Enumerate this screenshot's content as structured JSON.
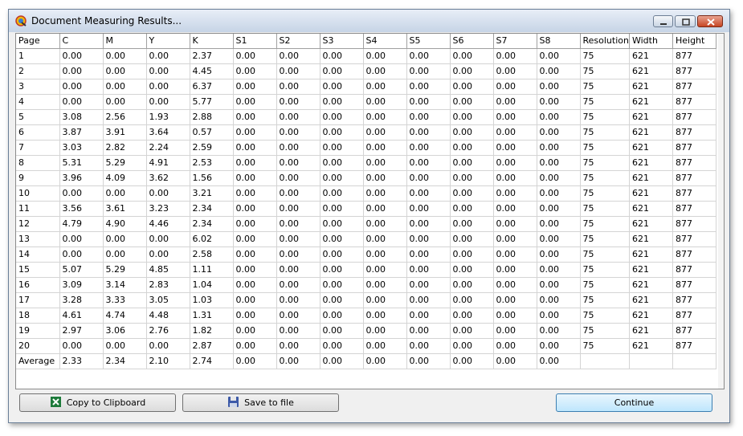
{
  "window": {
    "title": "Document Measuring Results...",
    "icon": "app-logo-icon"
  },
  "table": {
    "columns": [
      "Page",
      "C",
      "M",
      "Y",
      "K",
      "S1",
      "S2",
      "S3",
      "S4",
      "S5",
      "S6",
      "S7",
      "S8",
      "Resolution",
      "Width",
      "Height"
    ],
    "rows": [
      [
        "1",
        "0.00",
        "0.00",
        "0.00",
        "2.37",
        "0.00",
        "0.00",
        "0.00",
        "0.00",
        "0.00",
        "0.00",
        "0.00",
        "0.00",
        "75",
        "621",
        "877"
      ],
      [
        "2",
        "0.00",
        "0.00",
        "0.00",
        "4.45",
        "0.00",
        "0.00",
        "0.00",
        "0.00",
        "0.00",
        "0.00",
        "0.00",
        "0.00",
        "75",
        "621",
        "877"
      ],
      [
        "3",
        "0.00",
        "0.00",
        "0.00",
        "6.37",
        "0.00",
        "0.00",
        "0.00",
        "0.00",
        "0.00",
        "0.00",
        "0.00",
        "0.00",
        "75",
        "621",
        "877"
      ],
      [
        "4",
        "0.00",
        "0.00",
        "0.00",
        "5.77",
        "0.00",
        "0.00",
        "0.00",
        "0.00",
        "0.00",
        "0.00",
        "0.00",
        "0.00",
        "75",
        "621",
        "877"
      ],
      [
        "5",
        "3.08",
        "2.56",
        "1.93",
        "2.88",
        "0.00",
        "0.00",
        "0.00",
        "0.00",
        "0.00",
        "0.00",
        "0.00",
        "0.00",
        "75",
        "621",
        "877"
      ],
      [
        "6",
        "3.87",
        "3.91",
        "3.64",
        "0.57",
        "0.00",
        "0.00",
        "0.00",
        "0.00",
        "0.00",
        "0.00",
        "0.00",
        "0.00",
        "75",
        "621",
        "877"
      ],
      [
        "7",
        "3.03",
        "2.82",
        "2.24",
        "2.59",
        "0.00",
        "0.00",
        "0.00",
        "0.00",
        "0.00",
        "0.00",
        "0.00",
        "0.00",
        "75",
        "621",
        "877"
      ],
      [
        "8",
        "5.31",
        "5.29",
        "4.91",
        "2.53",
        "0.00",
        "0.00",
        "0.00",
        "0.00",
        "0.00",
        "0.00",
        "0.00",
        "0.00",
        "75",
        "621",
        "877"
      ],
      [
        "9",
        "3.96",
        "4.09",
        "3.62",
        "1.56",
        "0.00",
        "0.00",
        "0.00",
        "0.00",
        "0.00",
        "0.00",
        "0.00",
        "0.00",
        "75",
        "621",
        "877"
      ],
      [
        "10",
        "0.00",
        "0.00",
        "0.00",
        "3.21",
        "0.00",
        "0.00",
        "0.00",
        "0.00",
        "0.00",
        "0.00",
        "0.00",
        "0.00",
        "75",
        "621",
        "877"
      ],
      [
        "11",
        "3.56",
        "3.61",
        "3.23",
        "2.34",
        "0.00",
        "0.00",
        "0.00",
        "0.00",
        "0.00",
        "0.00",
        "0.00",
        "0.00",
        "75",
        "621",
        "877"
      ],
      [
        "12",
        "4.79",
        "4.90",
        "4.46",
        "2.34",
        "0.00",
        "0.00",
        "0.00",
        "0.00",
        "0.00",
        "0.00",
        "0.00",
        "0.00",
        "75",
        "621",
        "877"
      ],
      [
        "13",
        "0.00",
        "0.00",
        "0.00",
        "6.02",
        "0.00",
        "0.00",
        "0.00",
        "0.00",
        "0.00",
        "0.00",
        "0.00",
        "0.00",
        "75",
        "621",
        "877"
      ],
      [
        "14",
        "0.00",
        "0.00",
        "0.00",
        "2.58",
        "0.00",
        "0.00",
        "0.00",
        "0.00",
        "0.00",
        "0.00",
        "0.00",
        "0.00",
        "75",
        "621",
        "877"
      ],
      [
        "15",
        "5.07",
        "5.29",
        "4.85",
        "1.11",
        "0.00",
        "0.00",
        "0.00",
        "0.00",
        "0.00",
        "0.00",
        "0.00",
        "0.00",
        "75",
        "621",
        "877"
      ],
      [
        "16",
        "3.09",
        "3.14",
        "2.83",
        "1.04",
        "0.00",
        "0.00",
        "0.00",
        "0.00",
        "0.00",
        "0.00",
        "0.00",
        "0.00",
        "75",
        "621",
        "877"
      ],
      [
        "17",
        "3.28",
        "3.33",
        "3.05",
        "1.03",
        "0.00",
        "0.00",
        "0.00",
        "0.00",
        "0.00",
        "0.00",
        "0.00",
        "0.00",
        "75",
        "621",
        "877"
      ],
      [
        "18",
        "4.61",
        "4.74",
        "4.48",
        "1.31",
        "0.00",
        "0.00",
        "0.00",
        "0.00",
        "0.00",
        "0.00",
        "0.00",
        "0.00",
        "75",
        "621",
        "877"
      ],
      [
        "19",
        "2.97",
        "3.06",
        "2.76",
        "1.82",
        "0.00",
        "0.00",
        "0.00",
        "0.00",
        "0.00",
        "0.00",
        "0.00",
        "0.00",
        "75",
        "621",
        "877"
      ],
      [
        "20",
        "0.00",
        "0.00",
        "0.00",
        "2.87",
        "0.00",
        "0.00",
        "0.00",
        "0.00",
        "0.00",
        "0.00",
        "0.00",
        "0.00",
        "75",
        "621",
        "877"
      ],
      [
        "Average",
        "2.33",
        "2.34",
        "2.10",
        "2.74",
        "0.00",
        "0.00",
        "0.00",
        "0.00",
        "0.00",
        "0.00",
        "0.00",
        "0.00",
        "",
        "",
        ""
      ]
    ]
  },
  "buttons": {
    "copy_label": "Copy to Clipboard",
    "copy_icon": "excel-icon",
    "save_label": "Save to file",
    "save_icon": "floppy-disk-icon",
    "continue_label": "Continue"
  }
}
